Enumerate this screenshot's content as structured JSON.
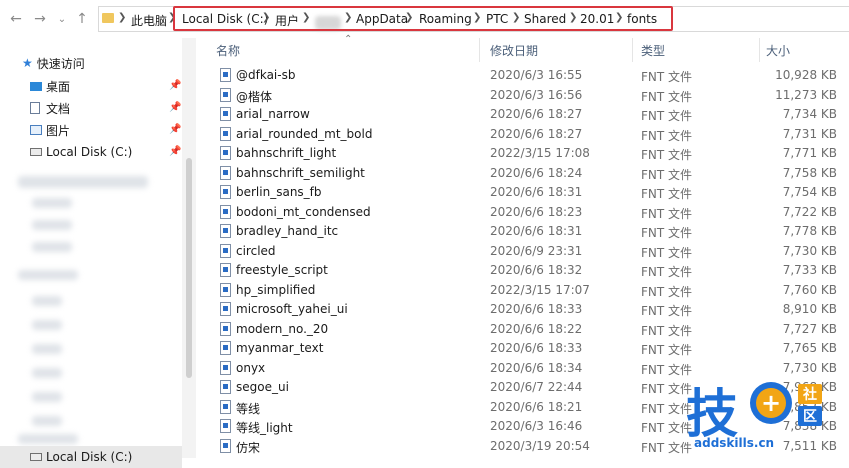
{
  "address_bar": {
    "crumbs": [
      "此电脑",
      "Local Disk (C:)",
      "用户",
      "AppData",
      "Roaming",
      "PTC",
      "Shared",
      "20.01",
      "fonts"
    ]
  },
  "sidebar": {
    "quick_access": "快速访问",
    "items": [
      {
        "label": "桌面",
        "icon": "desktop-icon",
        "pinned": true
      },
      {
        "label": "文档",
        "icon": "documents-icon",
        "pinned": true
      },
      {
        "label": "图片",
        "icon": "pictures-icon",
        "pinned": true
      },
      {
        "label": "Local Disk (C:)",
        "icon": "drive-icon",
        "pinned": true
      }
    ],
    "bottom_item": "Local Disk (C:)"
  },
  "columns": {
    "name": "名称",
    "date": "修改日期",
    "type": "类型",
    "size": "大小"
  },
  "files": [
    {
      "name": "@dfkai-sb",
      "date": "2020/6/3 16:55",
      "type": "FNT 文件",
      "size": "10,928 KB"
    },
    {
      "name": "@楷体",
      "date": "2020/6/3 16:56",
      "type": "FNT 文件",
      "size": "11,273 KB"
    },
    {
      "name": "arial_narrow",
      "date": "2020/6/6 18:27",
      "type": "FNT 文件",
      "size": "7,734 KB"
    },
    {
      "name": "arial_rounded_mt_bold",
      "date": "2020/6/6 18:27",
      "type": "FNT 文件",
      "size": "7,731 KB"
    },
    {
      "name": "bahnschrift_light",
      "date": "2022/3/15 17:08",
      "type": "FNT 文件",
      "size": "7,771 KB"
    },
    {
      "name": "bahnschrift_semilight",
      "date": "2020/6/6 18:24",
      "type": "FNT 文件",
      "size": "7,758 KB"
    },
    {
      "name": "berlin_sans_fb",
      "date": "2020/6/6 18:31",
      "type": "FNT 文件",
      "size": "7,754 KB"
    },
    {
      "name": "bodoni_mt_condensed",
      "date": "2020/6/6 18:23",
      "type": "FNT 文件",
      "size": "7,722 KB"
    },
    {
      "name": "bradley_hand_itc",
      "date": "2020/6/6 18:31",
      "type": "FNT 文件",
      "size": "7,778 KB"
    },
    {
      "name": "circled",
      "date": "2020/6/9 23:31",
      "type": "FNT 文件",
      "size": "7,730 KB"
    },
    {
      "name": "freestyle_script",
      "date": "2020/6/6 18:32",
      "type": "FNT 文件",
      "size": "7,733 KB"
    },
    {
      "name": "hp_simplified",
      "date": "2022/3/15 17:07",
      "type": "FNT 文件",
      "size": "7,760 KB"
    },
    {
      "name": "microsoft_yahei_ui",
      "date": "2020/6/6 18:33",
      "type": "FNT 文件",
      "size": "8,910 KB"
    },
    {
      "name": "modern_no._20",
      "date": "2020/6/6 18:22",
      "type": "FNT 文件",
      "size": "7,727 KB"
    },
    {
      "name": "myanmar_text",
      "date": "2020/6/6 18:33",
      "type": "FNT 文件",
      "size": "7,765 KB"
    },
    {
      "name": "onyx",
      "date": "2020/6/6 18:34",
      "type": "FNT 文件",
      "size": "7,730 KB"
    },
    {
      "name": "segoe_ui",
      "date": "2020/6/7 22:44",
      "type": "FNT 文件",
      "size": "7,968 KB"
    },
    {
      "name": "等线",
      "date": "2020/6/6 18:21",
      "type": "FNT 文件",
      "size": "7,852 KB"
    },
    {
      "name": "等线_light",
      "date": "2020/6/3 16:46",
      "type": "FNT 文件",
      "size": "7,838 KB"
    },
    {
      "name": "仿宋",
      "date": "2020/3/19 20:54",
      "type": "FNT 文件",
      "size": "7,511 KB"
    }
  ],
  "watermark": {
    "main_char": "技",
    "plus": "+",
    "side_top": "社",
    "side_bottom": "区",
    "url": "addskills.cn"
  },
  "colors": {
    "highlight_box": "#d9363e",
    "header_text": "#4c607a",
    "watermark_blue": "#1e6fd6",
    "watermark_orange": "#f2a515"
  }
}
